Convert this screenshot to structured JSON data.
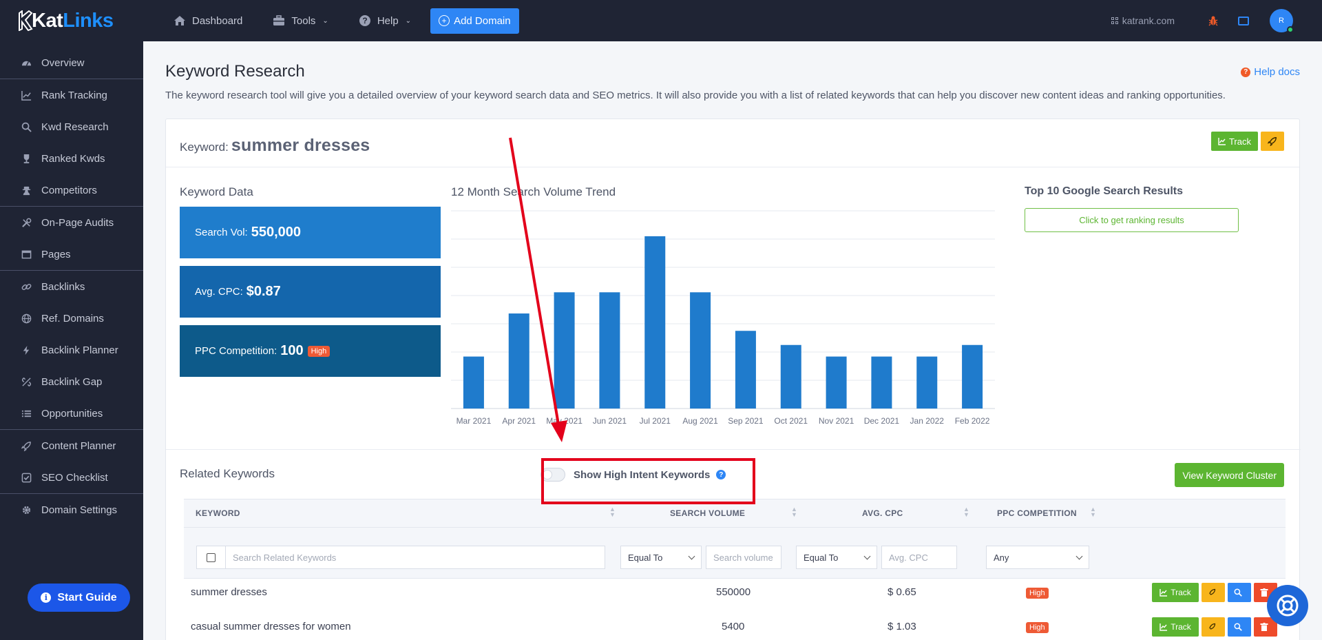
{
  "brand": {
    "part1": "Kat",
    "part2": "Links"
  },
  "sidebar": {
    "items": [
      {
        "label": "Overview",
        "icon": "gauge-icon"
      },
      {
        "label": "Rank Tracking",
        "icon": "line-chart-icon"
      },
      {
        "label": "Kwd Research",
        "icon": "search-icon"
      },
      {
        "label": "Ranked Kwds",
        "icon": "trophy-icon"
      },
      {
        "label": "Competitors",
        "icon": "user-secret-icon"
      },
      {
        "label": "On-Page Audits",
        "icon": "tools-icon"
      },
      {
        "label": "Pages",
        "icon": "window-icon"
      },
      {
        "label": "Backlinks",
        "icon": "link-icon"
      },
      {
        "label": "Ref. Domains",
        "icon": "globe-icon"
      },
      {
        "label": "Backlink Planner",
        "icon": "bolt-icon"
      },
      {
        "label": "Backlink Gap",
        "icon": "broken-link-icon"
      },
      {
        "label": "Opportunities",
        "icon": "list-icon"
      },
      {
        "label": "Content Planner",
        "icon": "rocket-icon"
      },
      {
        "label": "SEO Checklist",
        "icon": "checkbox-icon"
      },
      {
        "label": "Domain Settings",
        "icon": "gear-icon"
      }
    ],
    "start_guide": "Start Guide"
  },
  "topbar": {
    "dashboard": "Dashboard",
    "tools": "Tools",
    "help": "Help",
    "add_domain": "Add Domain",
    "site": "katrank.com",
    "avatar_initial": "R"
  },
  "page": {
    "title": "Keyword Research",
    "help_docs": "Help docs",
    "description": "The keyword research tool will give you a detailed overview of your keyword search data and SEO metrics. It will also provide you with a list of related keywords that can help you discover new content ideas and ranking opportunities."
  },
  "keyword": {
    "label": "Keyword:",
    "value": "summer dresses",
    "track": "Track"
  },
  "keyword_data": {
    "title": "Keyword Data",
    "search_vol_label": "Search Vol:",
    "search_vol": "550,000",
    "cpc_label": "Avg. CPC:",
    "cpc": "$0.87",
    "ppc_label": "PPC Competition:",
    "ppc": "100",
    "ppc_badge": "High"
  },
  "colors": {
    "metric1": "#1f7dcc",
    "metric2": "#1466ac",
    "metric3": "#0d5a8a",
    "bar": "#1f7bcc"
  },
  "trend": {
    "title": "12 Month Search Volume Trend"
  },
  "chart_data": {
    "type": "bar",
    "categories": [
      "Mar 2021",
      "Apr 2021",
      "May 2021",
      "Jun 2021",
      "Jul 2021",
      "Aug 2021",
      "Sep 2021",
      "Oct 2021",
      "Nov 2021",
      "Dec 2021",
      "Jan 2022",
      "Feb 2022"
    ],
    "values": [
      368000,
      673000,
      823000,
      823000,
      1220000,
      823000,
      550000,
      450000,
      368000,
      368000,
      368000,
      450000
    ],
    "ylim": [
      0,
      1400000
    ],
    "grid": true
  },
  "top10": {
    "title": "Top 10 Google Search Results",
    "button": "Click to get ranking results"
  },
  "related": {
    "title": "Related Keywords",
    "toggle_label": "Show High Intent Keywords",
    "cluster_button": "View Keyword Cluster",
    "columns": [
      "KEYWORD",
      "SEARCH VOLUME",
      "AVG. CPC",
      "PPC COMPETITION"
    ],
    "filters": {
      "keyword_placeholder": "Search Related Keywords",
      "vol_operator": "Equal To",
      "vol_placeholder": "Search volume",
      "cpc_operator": "Equal To",
      "cpc_placeholder": "Avg. CPC",
      "competition": "Any"
    },
    "rows": [
      {
        "keyword": "summer dresses",
        "volume": "550000",
        "cpc": "$ 0.65",
        "competition": "High"
      },
      {
        "keyword": "casual summer dresses for women",
        "volume": "5400",
        "cpc": "$ 1.03",
        "competition": "High"
      }
    ],
    "track": "Track"
  }
}
